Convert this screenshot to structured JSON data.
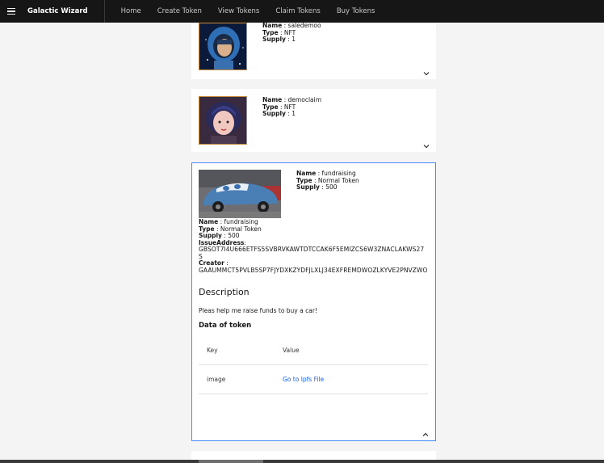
{
  "header": {
    "brand": "Galactic Wizard",
    "nav": [
      "Home",
      "Create Token",
      "View Tokens",
      "Claim Tokens",
      "Buy Tokens"
    ]
  },
  "labels": {
    "name": "Name",
    "type": "Type",
    "supply": "Supply",
    "issue_address": "IssueAddress",
    "creator": "Creator",
    "sep": " : "
  },
  "cards": [
    {
      "name": "saledemoo",
      "type": "NFT",
      "supply": "1"
    },
    {
      "name": "democlaim",
      "type": "NFT",
      "supply": "1"
    },
    {
      "name": "fundraising",
      "type": "Normal Token",
      "supply": "500",
      "issue_address": "GBSOT7I4U666ETFS5SVBRVKAWTDTCCAK6F5EMIZCS6W3ZNACLAKWS27S",
      "creator": "GAAUMMCT5PVLB5SP7FJYDXKZYDFJLXLJ34EXFREMDWOZLKYVE2PNVZWO",
      "description_title": "Description",
      "description": "Pleas help me raise funds to buy a car!",
      "data_title": "Data of token",
      "table_headers": [
        "Key",
        "Value"
      ],
      "table_rows": [
        {
          "key": "image",
          "value": "Go to Ipfs File"
        }
      ]
    }
  ],
  "colors": {
    "header_bg": "#161616",
    "accent": "#4589ff",
    "link": "#0f62fe",
    "thumb_border": "#c58a3a"
  }
}
